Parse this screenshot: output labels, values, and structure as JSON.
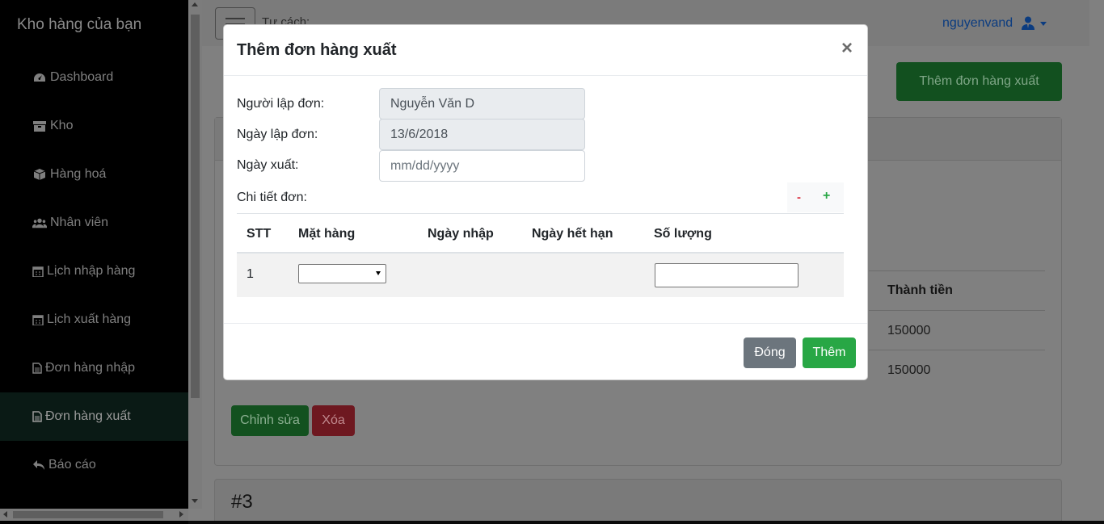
{
  "sidebar": {
    "brand": "Kho hàng của bạn",
    "items": [
      {
        "label": "Dashboard",
        "icon": "tachometer-icon"
      },
      {
        "label": "Kho",
        "icon": "archive-icon"
      },
      {
        "label": "Hàng hoá",
        "icon": "cube-icon"
      },
      {
        "label": "Nhân viên",
        "icon": "users-icon"
      },
      {
        "label": "Lịch nhập hàng",
        "icon": "calendar-icon"
      },
      {
        "label": "Lịch xuất hàng",
        "icon": "calendar-icon"
      },
      {
        "label": "Đơn hàng nhập",
        "icon": "file-icon"
      },
      {
        "label": "Đơn hàng xuất",
        "icon": "file-icon",
        "active": true
      },
      {
        "label": "Báo cáo",
        "icon": "reply-icon"
      }
    ]
  },
  "header": {
    "role_label": "Tư cách:",
    "username": "nguyenvand"
  },
  "background": {
    "add_order_button": "Thêm đơn hàng xuất",
    "table_header_total": "Thành tiền",
    "totals": [
      "150000",
      "150000"
    ],
    "edit_button": "Chỉnh sửa",
    "delete_button": "Xóa",
    "next_card_title": "#3"
  },
  "modal": {
    "title": "Thêm đơn hàng xuất",
    "close_symbol": "×",
    "creator_label": "Người lập đơn:",
    "creator_value": "Nguyễn Văn D",
    "created_date_label": "Ngày lập đơn:",
    "created_date_value": "13/6/2018",
    "export_date_label": "Ngày xuất:",
    "export_date_placeholder": "mm/dd/yyyy",
    "details_label": "Chi tiết đơn:",
    "remove_row": "-",
    "add_row": "+",
    "columns": [
      "STT",
      "Mặt hàng",
      "Ngày nhập",
      "Ngày hết hạn",
      "Số lượng"
    ],
    "rows": [
      {
        "stt": "1",
        "item": "",
        "import_date": "",
        "expiry_date": "",
        "quantity": ""
      }
    ],
    "close_button": "Đóng",
    "add_button": "Thêm"
  },
  "colors": {
    "sidebar_bg": "#000000",
    "primary_green": "#28a745",
    "danger_red": "#dc3545",
    "secondary_gray": "#6c757d",
    "link_blue": "#0b3c80"
  }
}
